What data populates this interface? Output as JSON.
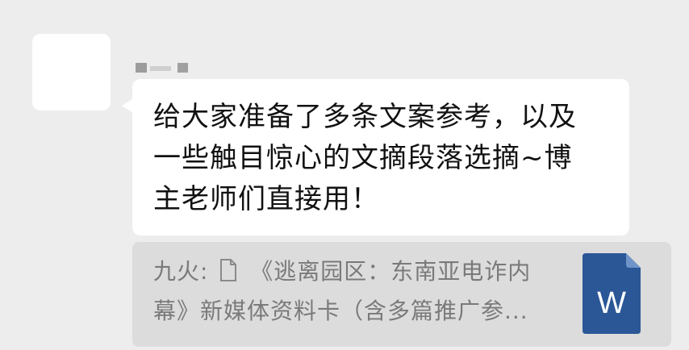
{
  "message": {
    "line1": "给大家准备了多条文案参考，以及",
    "line2": "一些触目惊心的文摘段落选摘~博",
    "line3": "主老师们直接用！"
  },
  "quote": {
    "sender": "九火:",
    "line1_text": "《逃离园区：东南亚电诈内",
    "line2_text": "幕》新媒体资料卡（含多篇推广参..."
  },
  "attachment": {
    "icon": "word-document-icon",
    "letter": "W",
    "color": "#2b5797"
  },
  "colors": {
    "background": "#ededed",
    "bubble": "#ffffff",
    "quote_bg": "#dcdcdc",
    "quote_text": "#7a7a7a"
  }
}
